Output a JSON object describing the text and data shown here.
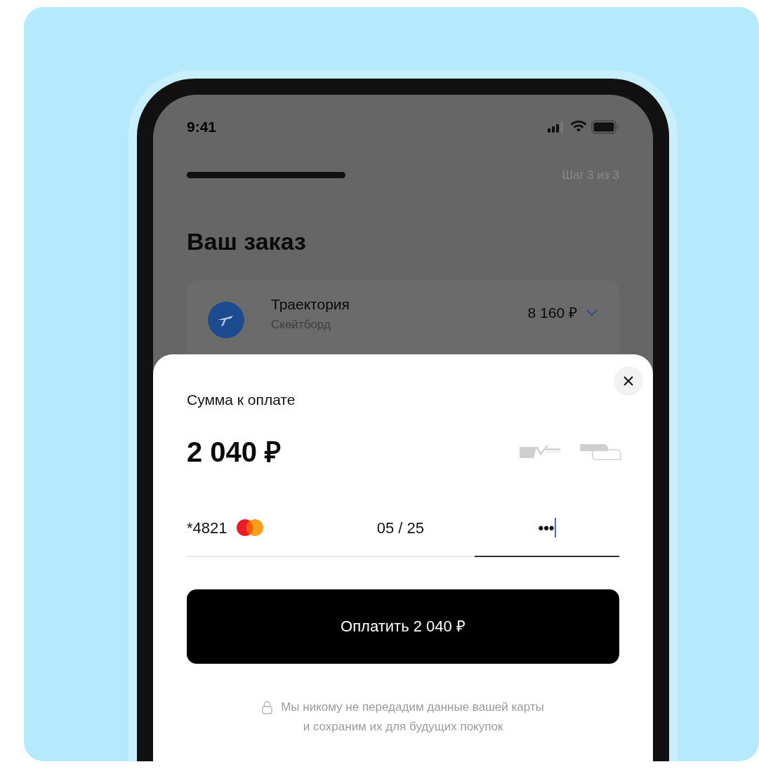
{
  "status_bar": {
    "time": "9:41"
  },
  "progress": {
    "level": 1,
    "step_label": "Шаг 3 из 3"
  },
  "title": "Ваш заказ",
  "order_item": {
    "name": "Траектория",
    "subtitle": "Скейтборд",
    "price": "8 160 ₽",
    "expanded": false
  },
  "payment_sheet": {
    "label": "Сумма к оплате",
    "amount": "2 040 ₽",
    "fields": [
      {
        "kind": "card",
        "value": "*4821",
        "focused": false
      },
      {
        "kind": "expiry",
        "value": "05 / 25",
        "focused": false
      },
      {
        "kind": "cvc",
        "value": "•••",
        "focused": true
      }
    ],
    "pay_button": "Оплатить 2 040 ₽",
    "note_lines": [
      "Мы никому не передадим данные вашей карты",
      "и сохраним их для будущих покупок"
    ]
  }
}
